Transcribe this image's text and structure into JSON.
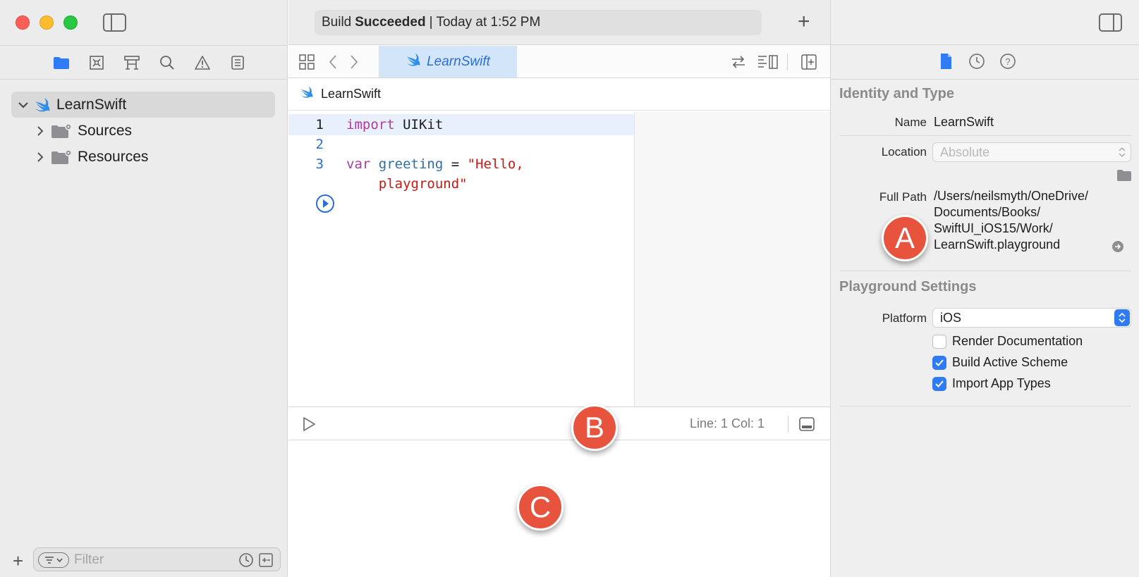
{
  "navigator": {
    "tabs": [
      "folder-icon",
      "source-control-icon",
      "symbol-icon",
      "find-icon",
      "issue-icon",
      "report-icon"
    ],
    "tree": {
      "root": "LearnSwift",
      "children": [
        "Sources",
        "Resources"
      ]
    },
    "filter_placeholder": "Filter"
  },
  "toolbar": {
    "status_prefix": "Build",
    "status_bold": "Succeeded",
    "status_suffix": "| Today at 1:52 PM"
  },
  "editor": {
    "tab_label": "LearnSwift",
    "jump_label": "LearnSwift",
    "lines": [
      {
        "number": "1",
        "tokens": [
          {
            "t": "import",
            "c": "kw"
          },
          {
            "t": " UIKit",
            "c": "ty"
          }
        ]
      },
      {
        "number": "2",
        "tokens": []
      },
      {
        "number": "3",
        "tokens": [
          {
            "t": "var",
            "c": "kw"
          },
          {
            "t": " ",
            "c": "op"
          },
          {
            "t": "greeting",
            "c": "id"
          },
          {
            "t": " = ",
            "c": "op"
          },
          {
            "t": "\"Hello,",
            "c": "str"
          }
        ]
      },
      {
        "number": "",
        "tokens": [
          {
            "t": "    ",
            "c": "op"
          },
          {
            "t": "playground\"",
            "c": "str"
          }
        ]
      }
    ],
    "line_col": "Line: 1  Col: 1"
  },
  "inspector": {
    "identity_title": "Identity and Type",
    "name_label": "Name",
    "name_value": "LearnSwift",
    "location_label": "Location",
    "location_value": "Absolute",
    "fullpath_label": "Full Path",
    "fullpath_lines": [
      "/Users/neilsmyth/OneDrive/",
      "Documents/Books/",
      "SwiftUI_iOS15/Work/",
      "LearnSwift.playground"
    ],
    "playground_title": "Playground Settings",
    "platform_label": "Platform",
    "platform_value": "iOS",
    "checkboxes": [
      {
        "label": "Render Documentation",
        "checked": false
      },
      {
        "label": "Build Active Scheme",
        "checked": true
      },
      {
        "label": "Import App Types",
        "checked": true
      }
    ]
  },
  "callouts": {
    "a": "A",
    "b": "B",
    "c": "C"
  },
  "colors": {
    "accent": "#2f7bf6",
    "callout": "#e8533e",
    "keyword": "#ad3da4",
    "string": "#c41a16"
  }
}
